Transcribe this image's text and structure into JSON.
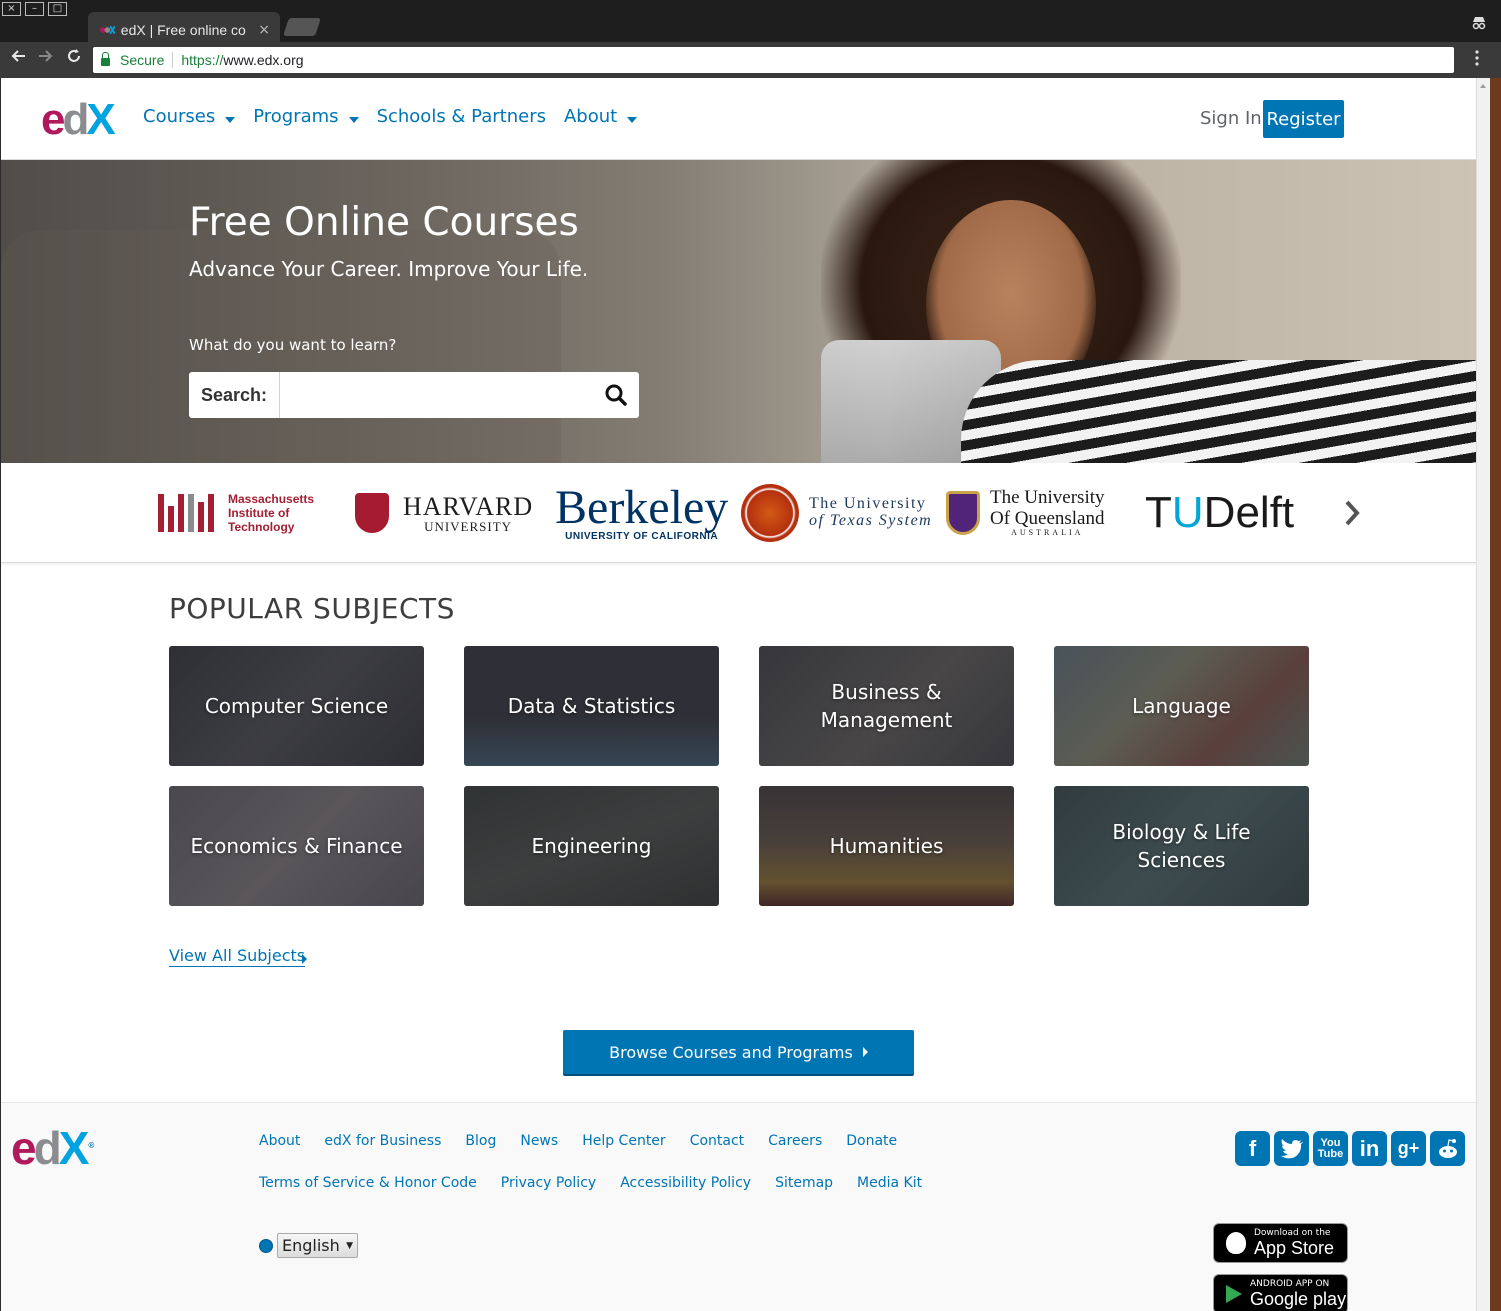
{
  "browser": {
    "tab_title": "edX | Free online co",
    "tab_close": "×",
    "secure_label": "Secure",
    "url_scheme": "https://",
    "url_host": "www.edx.org",
    "window_buttons": [
      "×",
      "–",
      "□"
    ]
  },
  "header": {
    "logo": {
      "e": "e",
      "d": "d",
      "x": "X"
    },
    "nav": [
      {
        "label": "Courses",
        "has_caret": true
      },
      {
        "label": "Programs",
        "has_caret": true
      },
      {
        "label": "Schools & Partners",
        "has_caret": false
      },
      {
        "label": "About",
        "has_caret": true
      }
    ],
    "sign_in": "Sign In",
    "register": "Register"
  },
  "hero": {
    "title": "Free Online Courses",
    "subtitle": "Advance Your Career. Improve Your Life.",
    "question": "What do you want to learn?",
    "search_label": "Search:",
    "search_value": ""
  },
  "partners": {
    "mit": [
      "Massachusetts",
      "Institute of",
      "Technology"
    ],
    "harvard": {
      "big": "HARVARD",
      "small": "UNIVERSITY"
    },
    "berkeley": {
      "big": "Berkeley",
      "small": "UNIVERSITY OF CALIFORNIA"
    },
    "texas": [
      "The University",
      "of Texas System"
    ],
    "queensland": {
      "line1": "The University",
      "line2": "Of Queensland",
      "small": "AUSTRALIA"
    },
    "tudelft": {
      "t": "T",
      "u": "U",
      "rest": "Delft"
    }
  },
  "subjects": {
    "title": "POPULAR SUBJECTS",
    "tiles": [
      {
        "label": "Computer Science"
      },
      {
        "label": "Data & Statistics"
      },
      {
        "label": "Business & Management"
      },
      {
        "label": "Language"
      },
      {
        "label": "Economics & Finance"
      },
      {
        "label": "Engineering"
      },
      {
        "label": "Humanities"
      },
      {
        "label": "Biology & Life Sciences"
      }
    ],
    "view_all": "View All Subjects"
  },
  "browse_button": "Browse Courses and Programs",
  "footer": {
    "links_row1": [
      "About",
      "edX for Business",
      "Blog",
      "News",
      "Help Center",
      "Contact",
      "Careers",
      "Donate"
    ],
    "links_row2": [
      "Terms of Service & Honor Code",
      "Privacy Policy",
      "Accessibility Policy",
      "Sitemap",
      "Media Kit"
    ],
    "language": "English",
    "social": [
      "facebook-icon",
      "twitter-icon",
      "youtube-icon",
      "linkedin-icon",
      "google-plus-icon",
      "reddit-icon"
    ],
    "youtube_text": {
      "top": "You",
      "bottom": "Tube"
    },
    "app_store": {
      "small": "Download on the",
      "big": "App Store"
    },
    "google_play": {
      "small": "ANDROID APP ON",
      "big": "Google play"
    }
  },
  "colors": {
    "brand_blue": "#0075b4",
    "edx_magenta": "#b0195b",
    "edx_gray": "#8a8c8f",
    "edx_cyan": "#00a2e0"
  }
}
